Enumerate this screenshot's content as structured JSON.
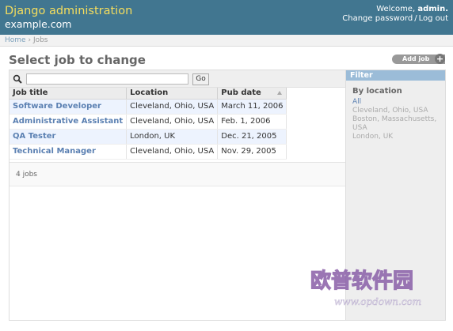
{
  "header": {
    "site_title": "Django administration",
    "site_subtitle": "example.com",
    "welcome": "Welcome,",
    "username": "admin.",
    "change_password": "Change password",
    "separator": "/",
    "logout": "Log out"
  },
  "breadcrumbs": {
    "home": "Home",
    "separator": "›",
    "current": "Jobs"
  },
  "page": {
    "heading": "Select job to change",
    "add_button": "Add job"
  },
  "search": {
    "value": "",
    "go_label": "Go"
  },
  "table": {
    "columns": [
      "Job title",
      "Location",
      "Pub date"
    ],
    "sorted_column": "Pub date",
    "rows": [
      {
        "title": "Software Developer",
        "location": "Cleveland, Ohio, USA",
        "pub_date": "March 11, 2006"
      },
      {
        "title": "Administrative Assistant",
        "location": "Cleveland, Ohio, USA",
        "pub_date": "Feb. 1, 2006"
      },
      {
        "title": "QA Tester",
        "location": "London, UK",
        "pub_date": "Dec. 21, 2005"
      },
      {
        "title": "Technical Manager",
        "location": "Cleveland, Ohio, USA",
        "pub_date": "Nov. 29, 2005"
      }
    ]
  },
  "paginator": {
    "count_text": "4 jobs"
  },
  "filter": {
    "title": "Filter",
    "group_title": "By location",
    "options": [
      "All",
      "Cleveland, Ohio, USA",
      "Boston, Massachusetts, USA",
      "London, UK"
    ],
    "selected": "All"
  },
  "watermark": {
    "text_cn": "欧普软件园",
    "url": "www.opdown.com"
  },
  "colors": {
    "header_bg": "#417690",
    "site_title": "#f5dd5d",
    "link": "#5b80b2",
    "filter_header": "#9bbcd8",
    "row_alt": "#edf3fe"
  }
}
